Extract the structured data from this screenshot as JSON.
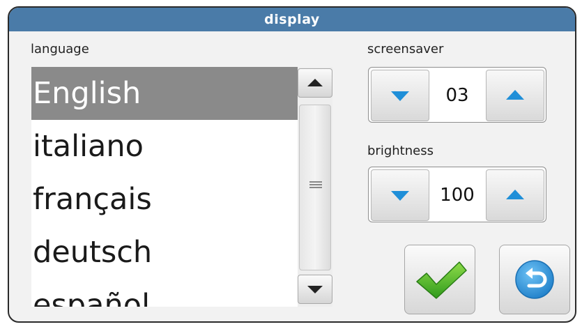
{
  "window": {
    "title": "display"
  },
  "language": {
    "label": "language",
    "items": [
      "English",
      "italiano",
      "français",
      "deutsch",
      "español"
    ],
    "selected": "English"
  },
  "screensaver": {
    "label": "screensaver",
    "value": "03"
  },
  "brightness": {
    "label": "brightness",
    "value": "100"
  },
  "colors": {
    "title_bar": "#4a7ba8",
    "spinner_arrow": "#1f8fd8",
    "confirm_icon": "#4caf2a",
    "back_icon": "#2f93db",
    "selected_row": "#8a8a8a"
  },
  "icons": {
    "confirm": "checkmark-icon",
    "back": "undo-arrow-icon"
  }
}
